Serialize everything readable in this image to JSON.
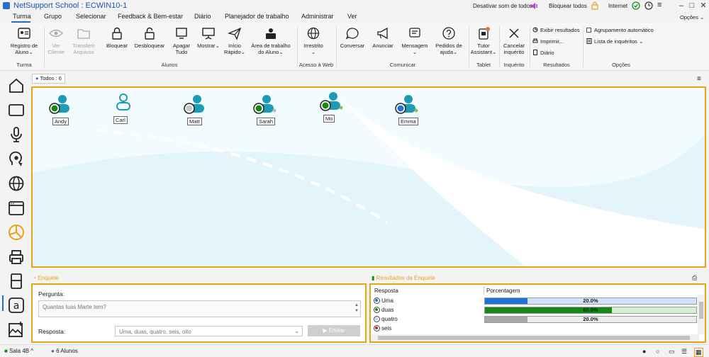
{
  "window": {
    "title": "NetSupport School : ECWIN10-1",
    "mute_all": "Desativar som de todos",
    "lock_all": "Bloquear todos",
    "internet": "Internet",
    "options": "Opções"
  },
  "menu": {
    "tabs": [
      "Turma",
      "Grupo",
      "Selecionar",
      "Feedback & Bem-estar",
      "Diário",
      "Planejador de trabalho",
      "Administrar",
      "Ver"
    ]
  },
  "ribbon": {
    "register": "Registro de Aluno",
    "view_client": "Ver Cliente",
    "transfer_files": "Transferir Arquivos",
    "lock": "Bloquear",
    "unlock": "Desbloquear",
    "blank_all": "Apagar Tudo",
    "show": "Mostrar",
    "quick_start": "Início Rápido",
    "student_desktop": "Área de trabalho do Aluno",
    "unrestricted": "Irrestrito",
    "chat": "Conversar",
    "announce": "Anunciar",
    "message": "Mensagem",
    "help_requests": "Pedidos de ajuda",
    "tutor_assistant": "Tutor Assistant",
    "cancel_survey": "Cancelar inquérito",
    "show_results": "Exibir resultados",
    "print": "Imprimir...",
    "journal": "Diário",
    "auto_grouping": "Agrupamento automático",
    "survey_list": "Lista de inquéritos",
    "groups": {
      "class": "Turma",
      "students": "Alunos",
      "web_access": "Acesso à Web",
      "communicate": "Comunicar",
      "tablet": "Tablet",
      "survey": "Inquérito",
      "results": "Resultados",
      "options": "Opções"
    }
  },
  "toolbar": {
    "all_label": "Todos : 6"
  },
  "students": [
    {
      "name": "Andy",
      "status": "green"
    },
    {
      "name": "Carl",
      "status": "none"
    },
    {
      "name": "Matt",
      "status": "gray"
    },
    {
      "name": "Sarah",
      "status": "green"
    },
    {
      "name": "Mo",
      "status": "green"
    },
    {
      "name": "Emma",
      "status": "blue"
    }
  ],
  "survey": {
    "panel_title": "Enquete",
    "question_label": "Pergunta:",
    "question_placeholder": "Quantas luas Marte tem?",
    "answer_label": "Resposta:",
    "answer_value": "Uma, duas, quatro, seis, oito",
    "send_label": "Enviar"
  },
  "results": {
    "panel_title": "Resultados da Enquete",
    "col_answer": "Resposta",
    "col_percent": "Porcentagem",
    "rows": [
      {
        "label": "Uma",
        "percent": 20.0,
        "percent_label": "20.0%",
        "color": "#1e73d6",
        "radio": "#1e73d6"
      },
      {
        "label": "duas",
        "percent": 60.0,
        "percent_label": "60.0%",
        "color": "#148a14",
        "radio": "#148a14"
      },
      {
        "label": "quatro",
        "percent": 20.0,
        "percent_label": "20.0%",
        "color": "#a8a8a8",
        "radio": "#d0d0d0"
      },
      {
        "label": "seis",
        "percent": 0,
        "percent_label": "",
        "color": "#d32020",
        "radio": "#d32020"
      }
    ]
  },
  "status": {
    "room": "Sala 4B",
    "students_count": "6 Alunos"
  },
  "colors": {
    "accent": "#e8a317",
    "brand": "#2a6bc9",
    "student_teal": "#1e9bb5"
  }
}
